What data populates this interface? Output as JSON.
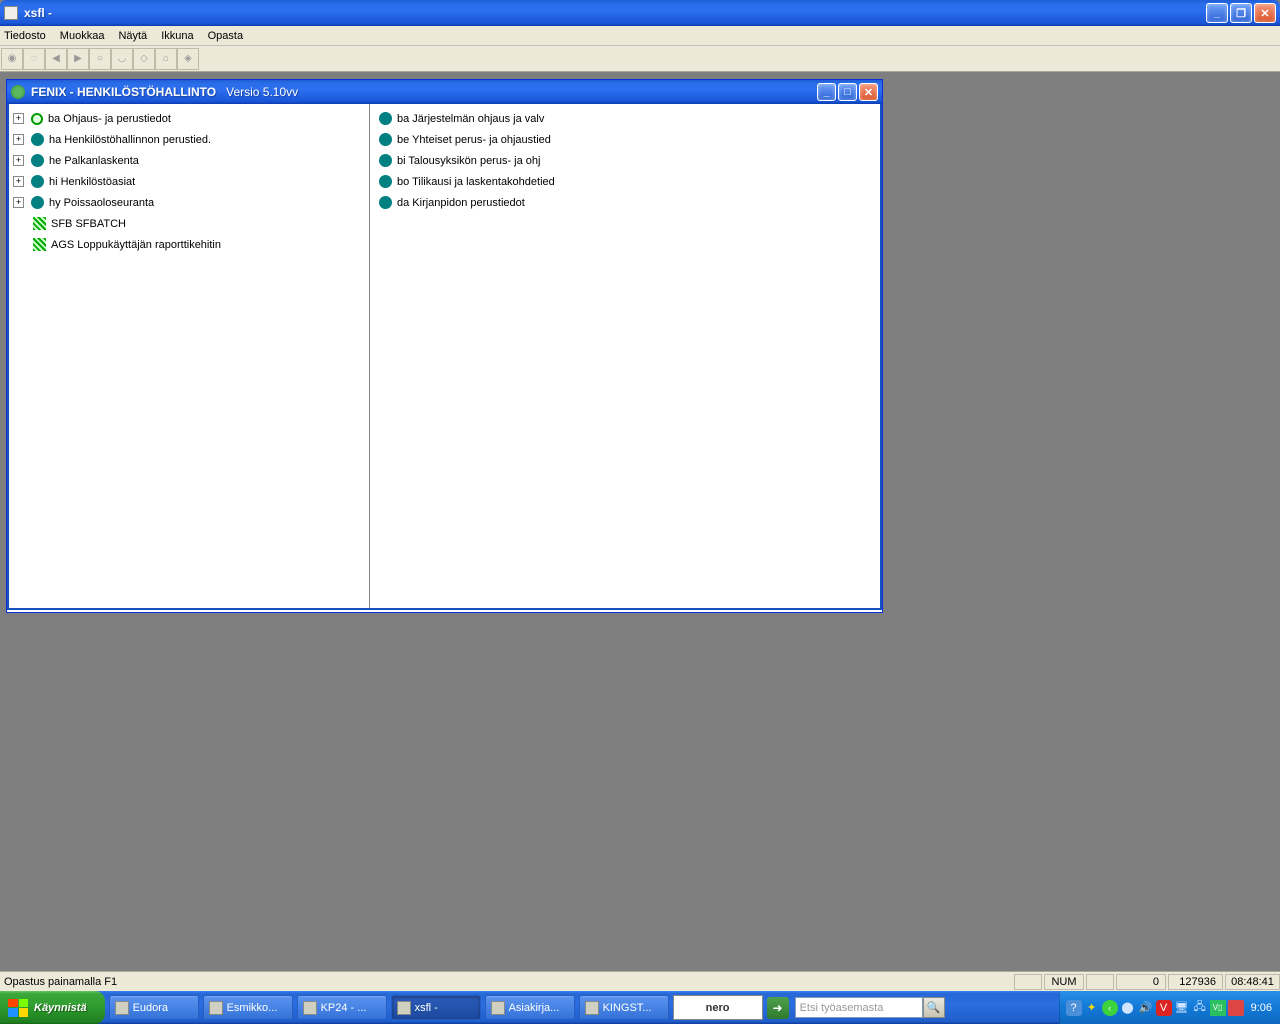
{
  "outer_window": {
    "title": "xsfl -"
  },
  "menubar": {
    "items": [
      "Tiedosto",
      "Muokkaa",
      "Näytä",
      "Ikkuna",
      "Opasta"
    ]
  },
  "inner_window": {
    "title": "FENIX  - HENKILÖSTÖHALLINTO",
    "version": "Versio 5.10vv"
  },
  "tree": {
    "items": [
      {
        "expand": true,
        "icon": "green-ring",
        "label": "ba  Ohjaus- ja perustiedot"
      },
      {
        "expand": true,
        "icon": "teal-dot",
        "label": "ha  Henkilöstöhallinnon perustied."
      },
      {
        "expand": true,
        "icon": "teal-dot",
        "label": "he  Palkanlaskenta"
      },
      {
        "expand": true,
        "icon": "teal-dot",
        "label": "hi  Henkilöstöasiat"
      },
      {
        "expand": true,
        "icon": "teal-dot",
        "label": "hy  Poissaoloseuranta"
      },
      {
        "expand": false,
        "icon": "green-grid",
        "label": "SFB SFBATCH"
      },
      {
        "expand": false,
        "icon": "green-grid",
        "label": "AGS Loppukäyttäjän raporttikehitin"
      }
    ]
  },
  "list": {
    "items": [
      "ba  Järjestelmän ohjaus ja valv",
      "be  Yhteiset perus- ja ohjaustied",
      "bi  Talousyksikön perus- ja ohj",
      "bo  Tilikausi ja laskentakohdetied",
      "da  Kirjanpidon perustiedot"
    ]
  },
  "statusbar": {
    "help": "Opastus painamalla F1",
    "num": "NUM",
    "val0": "0",
    "val1": "127936",
    "time": "08:48:41"
  },
  "taskbar": {
    "start": "Käynnistä",
    "tasks": [
      {
        "label": "Eudora",
        "active": false
      },
      {
        "label": "Esmikko...",
        "active": false
      },
      {
        "label": "KP24 - ...",
        "active": false
      },
      {
        "label": "xsfl -",
        "active": true
      },
      {
        "label": "Asiakirja...",
        "active": false
      },
      {
        "label": "KINGST...",
        "active": false
      }
    ],
    "nero": "nero",
    "search_placeholder": "Etsi työasemasta",
    "clock": "9:06"
  }
}
